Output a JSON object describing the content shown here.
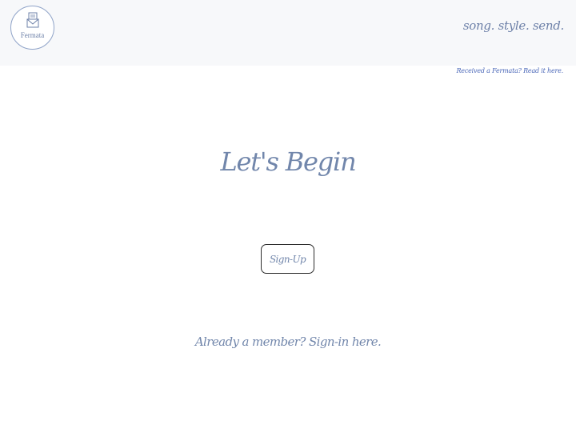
{
  "header": {
    "logo_text": "Fermata",
    "logo_icon": "envelope-icon",
    "tagline": "song. style. send.",
    "received_link": "Received a Fermata? Read it here."
  },
  "main": {
    "title": "Let's Begin",
    "signup_label": "Sign-Up",
    "signin_link": "Already a member? Sign-in here."
  },
  "colors": {
    "header_bg": "#f7f8fa",
    "accent_text": "#7186ab",
    "link_blue": "#4a67b8",
    "button_border": "#2b2b2b"
  }
}
